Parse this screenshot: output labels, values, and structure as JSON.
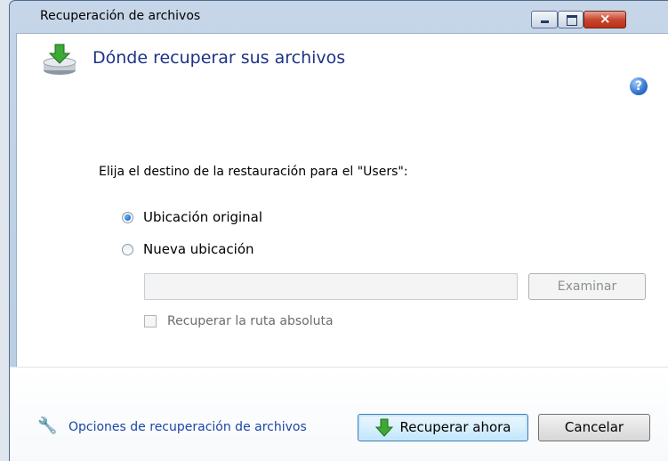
{
  "window": {
    "title": "Recuperación de archivos",
    "controls": {
      "minimize": "minimize",
      "maximize": "maximize",
      "close": "×"
    }
  },
  "header": {
    "title": "Dónde recuperar sus archivos",
    "help": "?"
  },
  "main": {
    "prompt": "Elija el destino de la restauración para el \"Users\":",
    "options": [
      {
        "label": "Ubicación original",
        "checked": true
      },
      {
        "label": "Nueva ubicación",
        "checked": false
      }
    ],
    "path_value": "",
    "browse_label": "Examinar",
    "absolute_path_label": "Recuperar la ruta absoluta"
  },
  "footer": {
    "options_link": "Opciones de recuperación de archivos",
    "recover_now": "Recuperar ahora",
    "cancel": "Cancelar"
  },
  "icons": {
    "header": "drive-download-icon",
    "help": "help-icon",
    "wrench": "wrench-icon",
    "recover": "green-down-arrow-icon"
  },
  "colors": {
    "title_blue": "#1e3287",
    "link_blue": "#1d46a8",
    "close_red": "#c8472f"
  }
}
